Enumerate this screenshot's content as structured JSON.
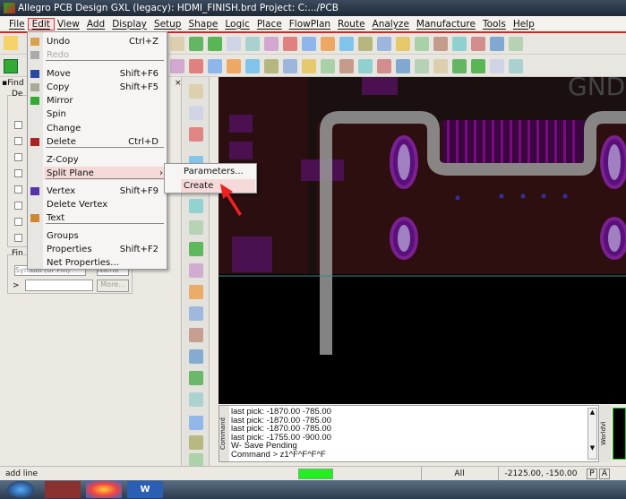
{
  "title": "Allegro PCB Design GXL (legacy): HDMI_FINISH.brd  Project: C:.../PCB",
  "menubar": [
    "File",
    "Edit",
    "View",
    "Add",
    "Display",
    "Setup",
    "Shape",
    "Logic",
    "Place",
    "FlowPlan",
    "Route",
    "Analyze",
    "Manufacture",
    "Tools",
    "Help"
  ],
  "edit_menu": [
    {
      "label": "Undo",
      "shortcut": "Ctrl+Z"
    },
    {
      "label": "Redo",
      "shortcut": "",
      "disabled": true
    },
    {
      "label": "Move",
      "shortcut": "Shift+F6"
    },
    {
      "label": "Copy",
      "shortcut": "Shift+F5"
    },
    {
      "label": "Mirror",
      "shortcut": ""
    },
    {
      "label": "Spin",
      "shortcut": ""
    },
    {
      "label": "Change",
      "shortcut": ""
    },
    {
      "label": "Delete",
      "shortcut": "Ctrl+D"
    },
    {
      "label": "Z-Copy",
      "shortcut": ""
    },
    {
      "label": "Split Plane",
      "shortcut": "",
      "highlighted": true,
      "submenu": true
    },
    {
      "label": "Vertex",
      "shortcut": "Shift+F9"
    },
    {
      "label": "Delete Vertex",
      "shortcut": ""
    },
    {
      "label": "Text",
      "shortcut": ""
    },
    {
      "label": "Groups",
      "shortcut": ""
    },
    {
      "label": "Properties",
      "shortcut": "Shift+F2"
    },
    {
      "label": "Net Properties...",
      "shortcut": ""
    }
  ],
  "split_plane_submenu": [
    {
      "label": "Parameters..."
    },
    {
      "label": "Create",
      "highlighted": true
    }
  ],
  "left_panel": {
    "tab": "Find",
    "group1": "De",
    "group2": "Fin",
    "find_by": "Symbol (or Pin)",
    "name_select": "Name",
    "more_button": "More...",
    "prompt": ">"
  },
  "canvas": {
    "label": "GND"
  },
  "command": {
    "lines": [
      "last pick:  -1870.00  -785.00",
      "last pick:  -1870.00  -785.00",
      "last pick:  -1870.00  -785.00",
      "last pick:  -1755.00  -900.00",
      "W- Save Pending",
      "Command > z1^F^F^F^F"
    ],
    "side_label": "Command",
    "world_label": "WorldVi"
  },
  "status": {
    "left": "add line",
    "mode": "All",
    "coords": "-2125.00, -150.00",
    "p": "P",
    "a": "A"
  },
  "colors": {
    "status_indicator": "#22ee22",
    "highlight": "#f6dada",
    "accent": "#dd2222"
  }
}
